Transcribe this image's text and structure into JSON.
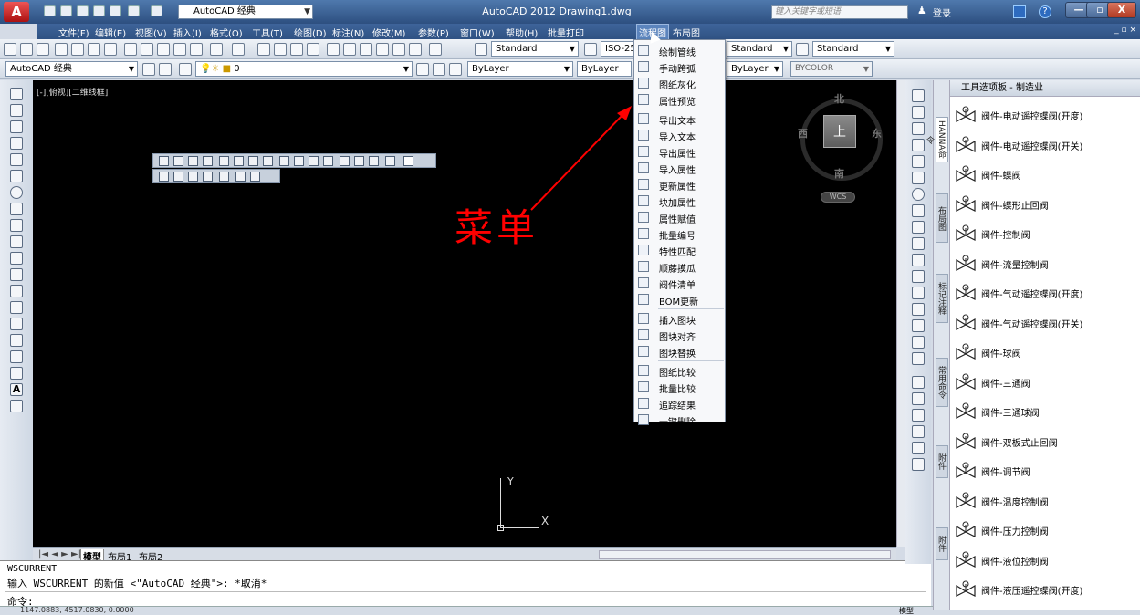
{
  "title_bar": {
    "workspace": "AutoCAD 经典",
    "document_title": "AutoCAD 2012   Drawing1.dwg",
    "search_placeholder": "键入关键字或短语",
    "login": "登录",
    "minimize": "—",
    "restore": "▫",
    "close": "X"
  },
  "menubar": {
    "items": [
      "文件(F)",
      "编辑(E)",
      "视图(V)",
      "插入(I)",
      "格式(O)",
      "工具(T)",
      "绘图(D)",
      "标注(N)",
      "修改(M)",
      "参数(P)",
      "窗口(W)",
      "帮助(H)",
      "批量打印",
      "流程图",
      "布局图"
    ],
    "active": "流程图",
    "mdi_controls": "_ ▫ ×"
  },
  "toolbar1": {
    "text_style": "Standard",
    "dim_style": "ISO-25",
    "table_style": "Standard",
    "multileader_style": "Standard"
  },
  "toolbar2": {
    "workspace": "AutoCAD 经典",
    "layer": "0",
    "color": "ByLayer",
    "linetype": "ByLayer",
    "lineweight": "ByLayer",
    "plotstyle": "BYCOLOR"
  },
  "drawing": {
    "viewport_label": "[-][俯视][二维线框]",
    "compass": {
      "north": "北",
      "south": "南",
      "east": "东",
      "west": "西",
      "top": "上"
    },
    "wcs": "WCS",
    "annotation": "菜单",
    "ucs_x": "X",
    "ucs_y": "Y",
    "annotation_color": "#ff0000"
  },
  "dropdown": {
    "items": [
      {
        "label": "绘制管线",
        "icon": "pipe-draw-icon"
      },
      {
        "label": "手动跨弧",
        "icon": "arc-jump-icon"
      },
      {
        "label": "图纸灰化",
        "icon": "gray-out-icon"
      },
      {
        "label": "属性预览",
        "icon": "attribute-preview-icon"
      },
      {
        "label": "导出文本",
        "icon": "export-text-icon"
      },
      {
        "label": "导入文本",
        "icon": "import-text-icon"
      },
      {
        "label": "导出属性",
        "icon": "export-attribute-icon"
      },
      {
        "label": "导入属性",
        "icon": "import-attribute-icon"
      },
      {
        "label": "更新属性",
        "icon": "update-attribute-icon"
      },
      {
        "label": "块加属性",
        "icon": "block-attribute-icon"
      },
      {
        "label": "属性赋值",
        "icon": "assign-attribute-icon"
      },
      {
        "label": "批量编号",
        "icon": "batch-number-icon"
      },
      {
        "label": "特性匹配",
        "icon": "match-properties-icon"
      },
      {
        "label": "顺藤摸瓜",
        "icon": "trace-icon"
      },
      {
        "label": "阀件清单",
        "icon": "valve-list-icon"
      },
      {
        "label": "BOM更新",
        "icon": "bom-update-icon"
      },
      {
        "label": "插入图块",
        "icon": "insert-block-icon"
      },
      {
        "label": "图块对齐",
        "icon": "block-align-icon"
      },
      {
        "label": "图块替换",
        "icon": "block-replace-icon"
      },
      {
        "label": "图纸比较",
        "icon": "drawing-compare-icon"
      },
      {
        "label": "批量比较",
        "icon": "batch-compare-icon"
      },
      {
        "label": "追踪结果",
        "icon": "trace-result-icon"
      },
      {
        "label": "一键删除",
        "icon": "delete-all-icon"
      }
    ]
  },
  "layout_tabs": [
    "模型",
    "布局1",
    "布局2"
  ],
  "command": {
    "line1": "WSCURRENT",
    "line2": "输入 WSCURRENT 的新值 <\"AutoCAD 经典\">: *取消*",
    "prompt": "命令:"
  },
  "status": {
    "coords": "1147.0883, 4517.0830, 0.0000",
    "model": "模型"
  },
  "palette": {
    "title": "工具选项板 - 制造业",
    "tabs": [
      "HANNA命令",
      "布局图",
      "标记注释",
      "常用命令",
      "附件",
      "附件"
    ],
    "items": [
      "阀件-电动遥控蝶阀(开度)",
      "阀件-电动遥控蝶阀(开关)",
      "阀件-蝶阀",
      "阀件-蝶形止回阀",
      "阀件-控制阀",
      "阀件-流量控制阀",
      "阀件-气动遥控蝶阀(开度)",
      "阀件-气动遥控蝶阀(开关)",
      "阀件-球阀",
      "阀件-三通阀",
      "阀件-三通球阀",
      "阀件-双板式止回阀",
      "阀件-调节阀",
      "阀件-温度控制阀",
      "阀件-压力控制阀",
      "阀件-液位控制阀",
      "阀件-液压遥控蝶阀(开度)"
    ]
  }
}
